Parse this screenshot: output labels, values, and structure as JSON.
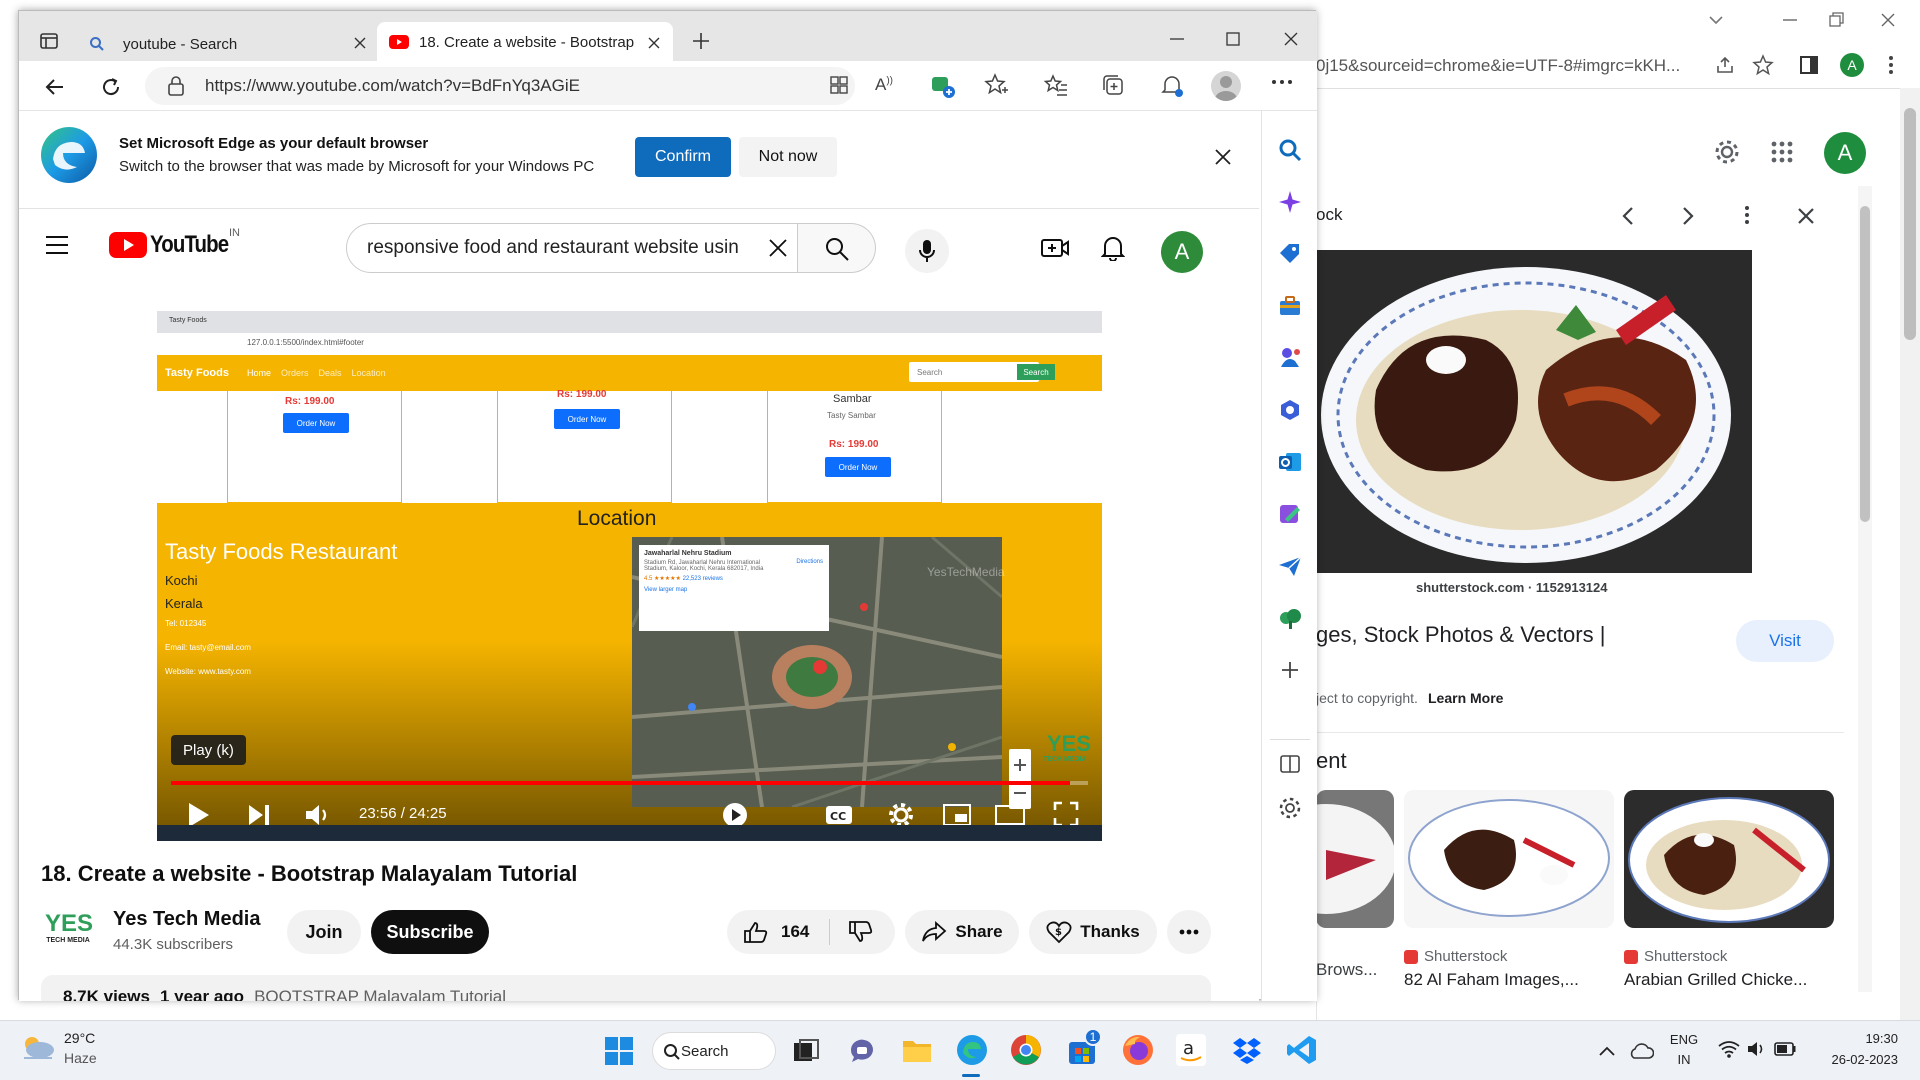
{
  "bg_window": {
    "url_fragment": "0j15&sourceid=chrome&ie=UTF-8#imgrc=kKH...",
    "avatar_letter": "A",
    "panel_title_fragment": "ock",
    "image_source": "shutterstock.com · 1152913124",
    "image_title_fragment": "ges, Stock Photos & Vectors |",
    "visit_label": "Visit",
    "copyright_fragment": "ject to copyright.",
    "learn_more": "Learn More",
    "related_heading_fragment": "ent",
    "related": [
      {
        "source": "",
        "title": "Brows..."
      },
      {
        "source": "Shutterstock",
        "title": "82 Al Faham Images,..."
      },
      {
        "source": "Shutterstock",
        "title": "Arabian Grilled Chicke..."
      }
    ]
  },
  "edge": {
    "tabs": [
      {
        "label": "youtube - Search"
      },
      {
        "label": "18. Create a website - Bootstrap"
      }
    ],
    "url": "https://www.youtube.com/watch?v=BdFnYq3AGiE",
    "infobar": {
      "title": "Set Microsoft Edge as your default browser",
      "subtitle": "Switch to the browser that was made by Microsoft for your Windows PC",
      "confirm": "Confirm",
      "not_now": "Not now"
    }
  },
  "youtube": {
    "logo_text": "YouTube",
    "region": "IN",
    "search_value": "responsive food and restaurant website usin",
    "avatar_letter": "A",
    "video": {
      "tooltip": "Play (k)",
      "time": "23:56 / 24:25",
      "progress": 0.98,
      "title": "18. Create a website - Bootstrap Malayalam Tutorial"
    },
    "screen": {
      "tab_title": "Tasty Foods",
      "url": "127.0.0.1:5500/index.html#footer",
      "brand": "Tasty Foods",
      "nav": [
        "Home",
        "Orders",
        "Deals",
        "Location"
      ],
      "search_placeholder": "Search",
      "search_btn": "Search",
      "cards": [
        {
          "price": "Rs: 199.00",
          "btn": "Order Now"
        },
        {
          "price": "Rs: 199.00",
          "btn": "Order Now"
        },
        {
          "name": "Sambar",
          "desc": "Tasty Sambar",
          "price": "Rs: 199.00",
          "btn": "Order Now"
        }
      ],
      "location_heading": "Location",
      "restaurant": "Tasty Foods Restaurant",
      "city": "Kochi",
      "state": "Kerala",
      "tel": "Tel: 012345",
      "email": "Email: tasty@email.com",
      "website": "Website: www.tasty.com",
      "map_place": "Jawaharlal Nehru Stadium",
      "map_address": "Stadium Rd, Jawaharlal Nehru International Stadium, Kaloor, Kochi, Kerala 682017, India",
      "map_rating": "4.5 ★★★★★",
      "map_reviews": "22,523 reviews",
      "map_larger": "View larger map",
      "map_directions": "Directions",
      "watermark": "YesTechMedia",
      "yes_mark": "YES",
      "yes_sub": "TECH MEDIA"
    },
    "channel": {
      "name": "Yes Tech Media",
      "subs": "44.3K subscribers",
      "logo_text": "YES",
      "logo_sub": "TECH MEDIA"
    },
    "buttons": {
      "join": "Join",
      "subscribe": "Subscribe",
      "likes": "164",
      "share": "Share",
      "thanks": "Thanks"
    },
    "description": {
      "views": "8.7K views",
      "ago": "1 year ago",
      "tag": "BOOTSTRAP Malayalam Tutorial"
    }
  },
  "taskbar": {
    "temp": "29°C",
    "weather": "Haze",
    "search": "Search",
    "lang": "ENG",
    "region": "IN",
    "time": "19:30",
    "date": "26-02-2023",
    "store_badge": "1"
  },
  "colors": {
    "accent_blue": "#0f6cbd",
    "yt_red": "#ff0000",
    "site_yellow": "#f5b400"
  }
}
